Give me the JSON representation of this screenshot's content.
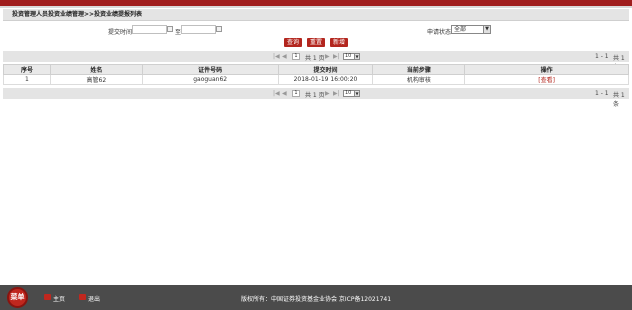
{
  "breadcrumb": "投资管理人员投资业绩管理>>投资业绩提报列表",
  "filter": {
    "submit_time_label": "提交时间",
    "to_label": "至",
    "status_label": "申请状态",
    "status_value": "全部"
  },
  "buttons": {
    "query": "查询",
    "reset": "重置",
    "add": "新增"
  },
  "pager": {
    "page_input": "1",
    "total_pages": "共 1 页",
    "page_size": "10",
    "range": "1 - 1",
    "total_records": "共 1 条"
  },
  "table": {
    "columns": [
      "序号",
      "姓名",
      "证件号码",
      "提交时间",
      "当前步骤",
      "操作"
    ],
    "rows": [
      {
        "no": "1",
        "name": "高管62",
        "id_number": "gaoguan62",
        "submit_time": "2018-01-19 16:00:20",
        "step": "机构审核",
        "action": "[查看]"
      }
    ]
  },
  "footer": {
    "menu": "菜单",
    "home": "主页",
    "logout": "退出",
    "copyright": "版权所有：中国证券投资基金业协会  京ICP备12021741"
  },
  "colors": {
    "brand_red": "#b3261e",
    "footer_bg": "#4b4b4b"
  }
}
